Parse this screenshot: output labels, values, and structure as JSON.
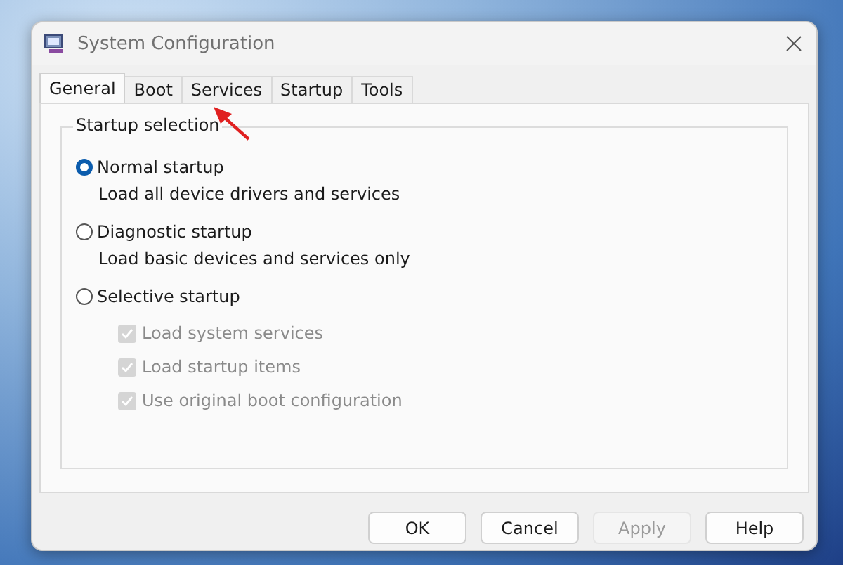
{
  "window": {
    "title": "System Configuration"
  },
  "tabs": [
    {
      "label": "General",
      "selected": true
    },
    {
      "label": "Boot",
      "selected": false
    },
    {
      "label": "Services",
      "selected": false
    },
    {
      "label": "Startup",
      "selected": false
    },
    {
      "label": "Tools",
      "selected": false
    }
  ],
  "group": {
    "title": "Startup selection",
    "options": [
      {
        "label": "Normal startup",
        "description": "Load all device drivers and services",
        "selected": true
      },
      {
        "label": "Diagnostic startup",
        "description": "Load basic devices and services only",
        "selected": false
      },
      {
        "label": "Selective startup",
        "selected": false,
        "children": [
          {
            "label": "Load system services",
            "checked": true,
            "disabled": true
          },
          {
            "label": "Load startup items",
            "checked": true,
            "disabled": true
          },
          {
            "label": "Use original boot configuration",
            "checked": true,
            "disabled": true
          }
        ]
      }
    ]
  },
  "buttons": [
    {
      "label": "OK",
      "disabled": false
    },
    {
      "label": "Cancel",
      "disabled": false
    },
    {
      "label": "Apply",
      "disabled": true
    },
    {
      "label": "Help",
      "disabled": false
    }
  ]
}
